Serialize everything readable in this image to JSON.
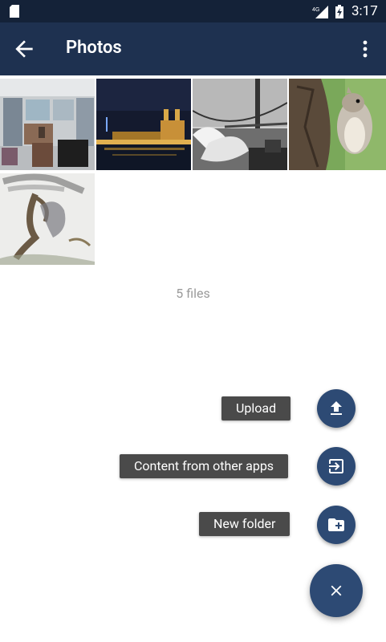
{
  "status_bar": {
    "time": "3:17",
    "network": "4G",
    "icons": [
      "sd-card-icon",
      "signal-icon",
      "battery-charging-icon"
    ]
  },
  "app_bar": {
    "title": "Photos",
    "back_icon": "arrow-back-icon",
    "menu_icon": "more-vert-icon"
  },
  "photos": [
    {
      "subject": "store-interior"
    },
    {
      "subject": "notre-dame-night"
    },
    {
      "subject": "golden-gate-waves"
    },
    {
      "subject": "squirrel"
    },
    {
      "subject": "tree-ink-painting"
    }
  ],
  "file_count": "5 files",
  "fab_menu": {
    "upload_label": "Upload",
    "content_label": "Content from other apps",
    "new_folder_label": "New folder",
    "close_icon": "close-icon"
  },
  "colors": {
    "status_bar": "#142238",
    "app_bar": "#1e3150",
    "fab": "#2d4a74",
    "label_bg": "#4a4a4a"
  }
}
